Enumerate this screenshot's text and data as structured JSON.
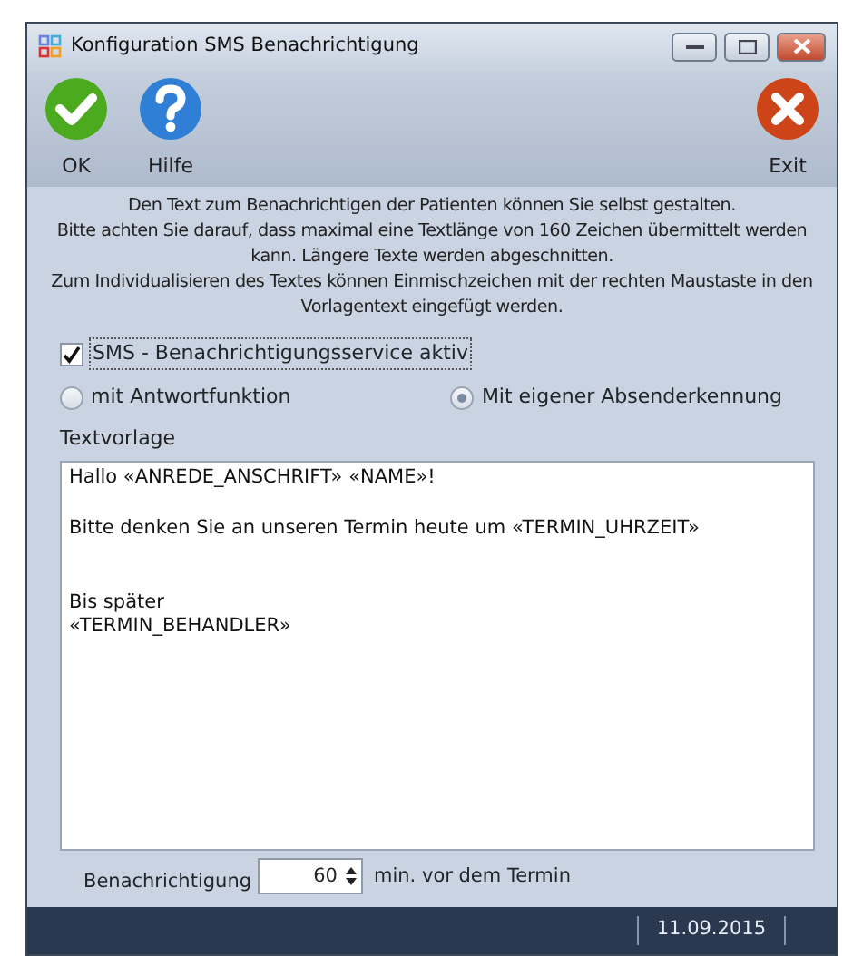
{
  "window": {
    "title": "Konfiguration SMS Benachrichtigung"
  },
  "toolbar": [
    {
      "kind": "ok",
      "label": "OK"
    },
    {
      "kind": "help",
      "label": "Hilfe"
    },
    {
      "kind": "exit",
      "label": "Exit"
    }
  ],
  "info_lines": [
    "Den Text zum Benachrichtigen der Patienten können Sie selbst gestalten.",
    "Bitte achten Sie darauf, dass maximal eine Textlänge von 160 Zeichen übermittelt werden kann. Längere Texte werden abgeschnitten.",
    "Zum Individualisieren des Textes können Einmischzeichen mit der rechten Maustaste in den Vorlagentext eingefügt werden."
  ],
  "sms_service": {
    "label": "SMS - Benachrichtigungsservice aktiv",
    "checked": true
  },
  "options": [
    {
      "label": "mit Antwortfunktion",
      "selected": false
    },
    {
      "label": "Mit eigener Absenderkennung",
      "selected": true
    }
  ],
  "template": {
    "label": "Textvorlage",
    "value": "Hallo «ANREDE_ANSCHRIFT» «NAME»!\n\nBitte denken Sie an unseren Termin heute um «TERMIN_UHRZEIT»\n\n\nBis später\n«TERMIN_BEHANDLER»"
  },
  "notification": {
    "label": "Benachrichtigung",
    "value": "60",
    "unit": "min. vor dem Termin"
  },
  "status_bar": {
    "date": "11.09.2015"
  }
}
